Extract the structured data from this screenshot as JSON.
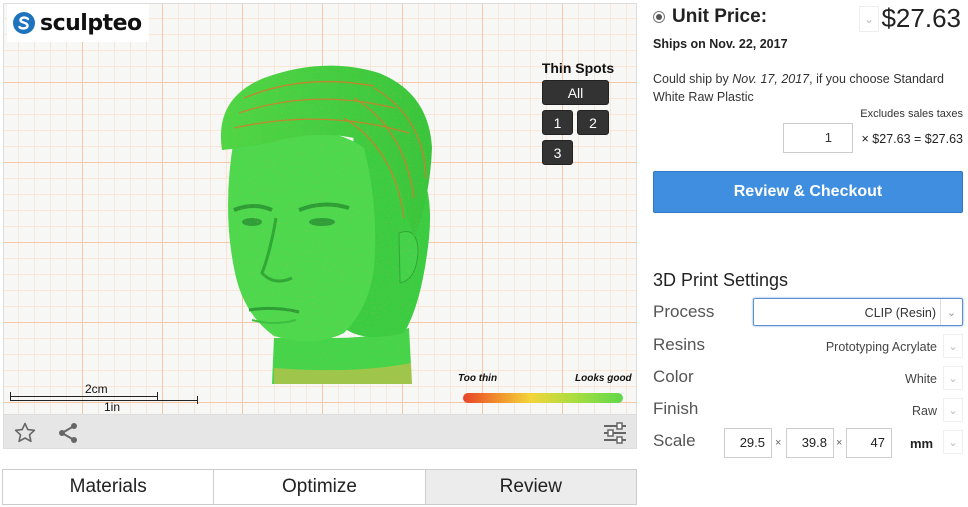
{
  "brand": {
    "name": "sculpteo"
  },
  "viewer": {
    "thin_spots": {
      "title": "Thin Spots",
      "buttons": [
        "All",
        "1",
        "2",
        "3"
      ]
    },
    "legend": {
      "min_label": "Too thin",
      "max_label": "Looks good"
    },
    "ruler": {
      "metric": "2cm",
      "imperial": "1in"
    }
  },
  "tabs": [
    "Materials",
    "Optimize",
    "Review"
  ],
  "pricing": {
    "unit_price_label": "Unit Price:",
    "unit_price": "$27.63",
    "ships_on": "Ships on Nov. 22, 2017",
    "could_ship_prefix": "Could ship by ",
    "could_ship_date": "Nov. 17, 2017",
    "could_ship_suffix": ", if you choose Standard White Raw Plastic",
    "excludes_taxes": "Excludes sales taxes",
    "quantity": "1",
    "calc": "× $27.63 = $27.63",
    "checkout_label": "Review & Checkout"
  },
  "settings": {
    "title": "3D Print Settings",
    "process": {
      "label": "Process",
      "value": "CLIP (Resin)"
    },
    "resins": {
      "label": "Resins",
      "value": "Prototyping Acrylate"
    },
    "color": {
      "label": "Color",
      "value": "White"
    },
    "finish": {
      "label": "Finish",
      "value": "Raw"
    },
    "scale": {
      "label": "Scale",
      "x": "29.5",
      "y": "39.8",
      "z": "47",
      "unit": "mm",
      "sep": "×"
    }
  },
  "colors": {
    "accent": "#3f8ee0",
    "model": "#3fd84a",
    "thin": "#e8432a"
  }
}
